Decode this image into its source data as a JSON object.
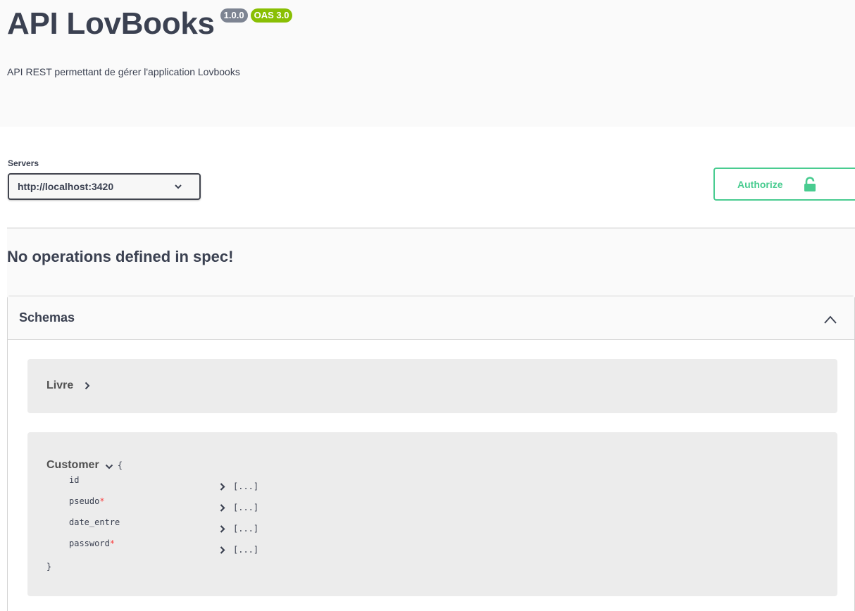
{
  "info": {
    "title": "API LovBooks",
    "version_badge": "1.0.0",
    "oas_badge": "OAS 3.0",
    "description": "API REST permettant de gérer l'application Lovbooks"
  },
  "servers": {
    "label": "Servers",
    "selected": "http://localhost:3420"
  },
  "authorize": {
    "label": "Authorize",
    "icon": "lock-icon",
    "color": "#49cc90"
  },
  "operations": {
    "empty_message": "No operations defined in spec!"
  },
  "schemas": {
    "title": "Schemas",
    "expanded": true,
    "models": [
      {
        "name": "Livre",
        "expanded": false
      },
      {
        "name": "Customer",
        "expanded": true,
        "open_brace": "{",
        "close_brace": "}",
        "properties": [
          {
            "name": "id",
            "required": false,
            "value": "[...]"
          },
          {
            "name": "pseudo",
            "required": true,
            "value": "[...]"
          },
          {
            "name": "date_entre",
            "required": false,
            "value": "[...]"
          },
          {
            "name": "password",
            "required": true,
            "value": "[...]"
          }
        ],
        "required_marker": "*"
      }
    ]
  },
  "colors": {
    "text": "#3b4151",
    "version_badge": "#7d8492",
    "oas_badge": "#89bf04",
    "required": "#f93e3e",
    "model_bg": "#ececec"
  }
}
